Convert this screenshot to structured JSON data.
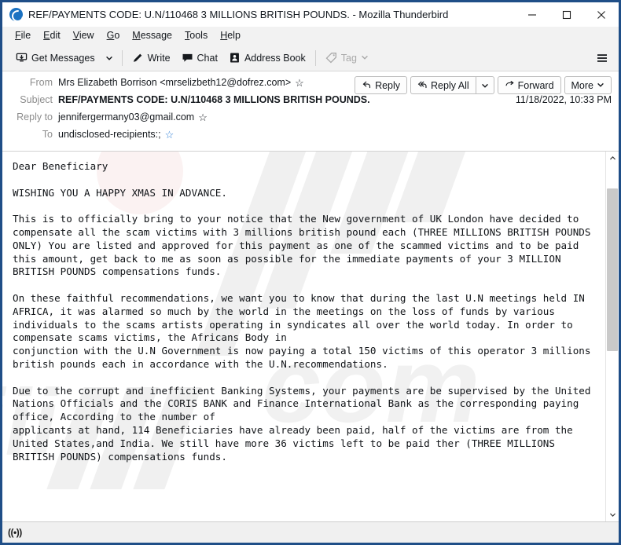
{
  "window": {
    "title": "REF/PAYMENTS CODE: U.N/110468 3 MILLIONS BRITISH POUNDS. - Mozilla Thunderbird",
    "app_icon": "thunderbird-icon",
    "minimize_label": "–",
    "maximize_label": "□",
    "close_label": "✕",
    "frame_color": "#1f4e87"
  },
  "menubar": {
    "items": [
      {
        "label": "File",
        "accesskey": "F"
      },
      {
        "label": "Edit",
        "accesskey": "E"
      },
      {
        "label": "View",
        "accesskey": "V"
      },
      {
        "label": "Go",
        "accesskey": "G"
      },
      {
        "label": "Message",
        "accesskey": "M"
      },
      {
        "label": "Tools",
        "accesskey": "T"
      },
      {
        "label": "Help",
        "accesskey": "H"
      }
    ]
  },
  "toolbar": {
    "get_messages": "Get Messages",
    "get_messages_caret": "⌄",
    "write": "Write",
    "chat": "Chat",
    "address_book": "Address Book",
    "tag": "Tag",
    "tag_caret": "⌄",
    "app_menu": "app-menu"
  },
  "message_header": {
    "from_label": "From",
    "from_value": "Mrs Elizabeth Borrison <mrselizbeth12@dofrez.com>",
    "from_star": "☆",
    "subject_label": "Subject",
    "subject_value": "REF/PAYMENTS CODE: U.N/110468 3 MILLIONS BRITISH POUNDS.",
    "date": "11/18/2022, 10:33 PM",
    "reply_to_label": "Reply to",
    "reply_to_value": "jennifergermany03@gmail.com",
    "reply_to_star": "☆",
    "to_label": "To",
    "to_value": "undisclosed-recipients:;",
    "to_star": "☆",
    "to_star_color": "#2f7fd6"
  },
  "actions": {
    "reply": "Reply",
    "reply_all": "Reply All",
    "reply_all_caret": "⌄",
    "forward": "Forward",
    "more": "More",
    "more_caret": "⌄"
  },
  "message_body": {
    "paragraphs": [
      "Dear Beneficiary",
      "WISHING YOU A HAPPY XMAS IN ADVANCE.",
      "This is to officially bring to your notice that the New government of UK London have decided to compensate all the scam victims with 3 millions british pound each (THREE MILLIONS BRITISH POUNDS ONLY) You are listed and approved for this payment as one of the scammed victims and to be paid this amount, get back to me as soon as possible for the immediate payments of your 3 MILLION BRITISH POUNDS compensations funds.",
      "On these faithful recommendations, we want you to know that during the last U.N meetings held IN AFRICA, it was alarmed so much by the world in the meetings on the loss of funds by various individuals to the scams artists operating in syndicates all over the world today. In order to compensate scams victims, the Africans Body in\nconjunction with the U.N Government is now paying a total 150 victims of this operator 3 millions british pounds each in accordance with the U.N.recommendations.",
      "Due to the corrupt and inefficient Banking Systems, your payments are be supervised by the United Nations Officials and the CORIS BANK and Finance International Bank as the corresponding paying office, According to the number of\napplicants at hand, 114 Beneficiaries have already been paid, half of the victims are from the United States,and India. We still have more 36 victims left to be paid ther (THREE MILLIONS BRITISH POUNDS) compensations funds."
    ]
  },
  "scrollbar": {
    "up_arrow": "⌃",
    "down_arrow": "⌄"
  },
  "statusbar": {
    "icon_label": "((•))"
  }
}
